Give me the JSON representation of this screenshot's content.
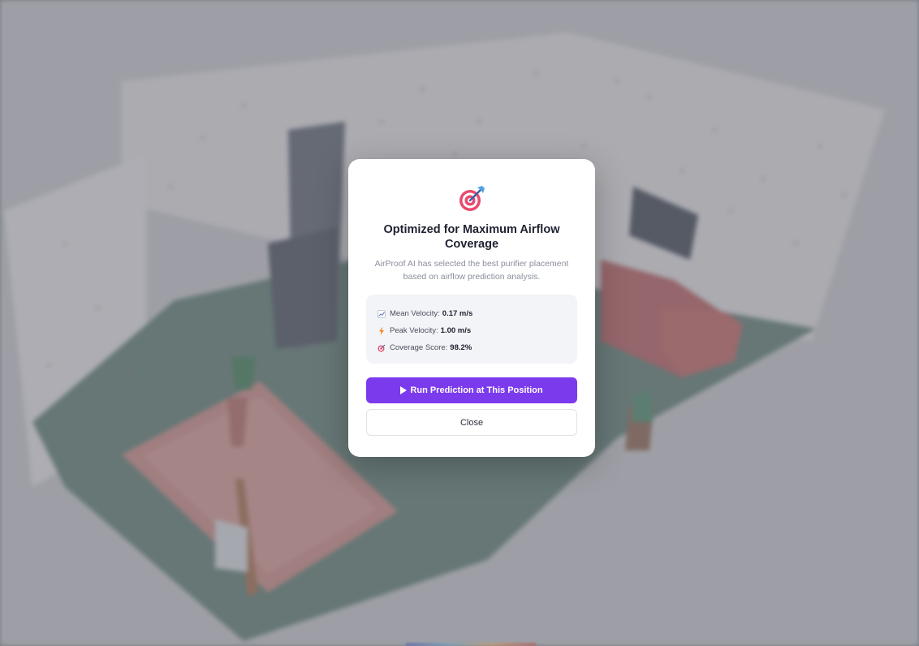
{
  "modal": {
    "title": "Optimized for Maximum Airflow Coverage",
    "description": "AirProof AI has selected the best purifier placement based on airflow prediction analysis.",
    "icon": "target-icon",
    "stats": [
      {
        "icon": "chart-icon",
        "label": "Mean Velocity:",
        "value": "0.17 m/s"
      },
      {
        "icon": "lightning-icon",
        "label": "Peak Velocity:",
        "value": "1.00 m/s"
      },
      {
        "icon": "target-icon",
        "label": "Coverage Score:",
        "value": "98.2%"
      }
    ],
    "run_button_label": "Run Prediction at This Position",
    "close_button_label": "Close"
  },
  "colors": {
    "accent": "#7c3aed",
    "overlay": "#7d7e86",
    "stats_bg": "#f3f4f7"
  }
}
